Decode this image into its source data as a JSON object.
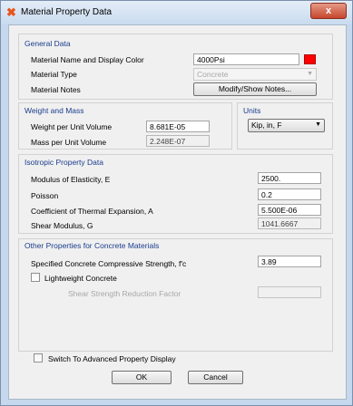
{
  "window": {
    "title": "Material Property Data",
    "close_glyph": "x"
  },
  "general": {
    "header": "General Data",
    "name_label": "Material Name and Display Color",
    "name_value": "4000Psi",
    "display_color": "#ff0000",
    "type_label": "Material Type",
    "type_value": "Concrete",
    "notes_label": "Material Notes",
    "notes_button": "Modify/Show Notes..."
  },
  "weight": {
    "header": "Weight and Mass",
    "wpuv_label": "Weight per Unit Volume",
    "wpuv_value": "8.681E-05",
    "mpuv_label": "Mass per Unit Volume",
    "mpuv_value": "2.248E-07"
  },
  "units": {
    "header": "Units",
    "value": "Kip, in, F"
  },
  "isotropic": {
    "header": "Isotropic Property Data",
    "e_label": "Modulus of Elasticity,  E",
    "e_value": "2500.",
    "poisson_label": "Poisson",
    "poisson_value": "0.2",
    "cte_label": "Coefficient of Thermal Expansion,  A",
    "cte_value": "5.500E-06",
    "g_label": "Shear Modulus,  G",
    "g_value": "1041.6667"
  },
  "concrete": {
    "header": "Other Properties for Concrete Materials",
    "fc_label": "Specified Concrete Compressive Strength, f'c",
    "fc_value": "3.89",
    "lightweight_label": "Lightweight Concrete",
    "lightweight_checked": false,
    "ssrf_label": "Shear Strength Reduction Factor",
    "ssrf_value": ""
  },
  "advanced": {
    "label": "Switch To Advanced Property Display",
    "checked": false
  },
  "buttons": {
    "ok": "OK",
    "cancel": "Cancel"
  }
}
